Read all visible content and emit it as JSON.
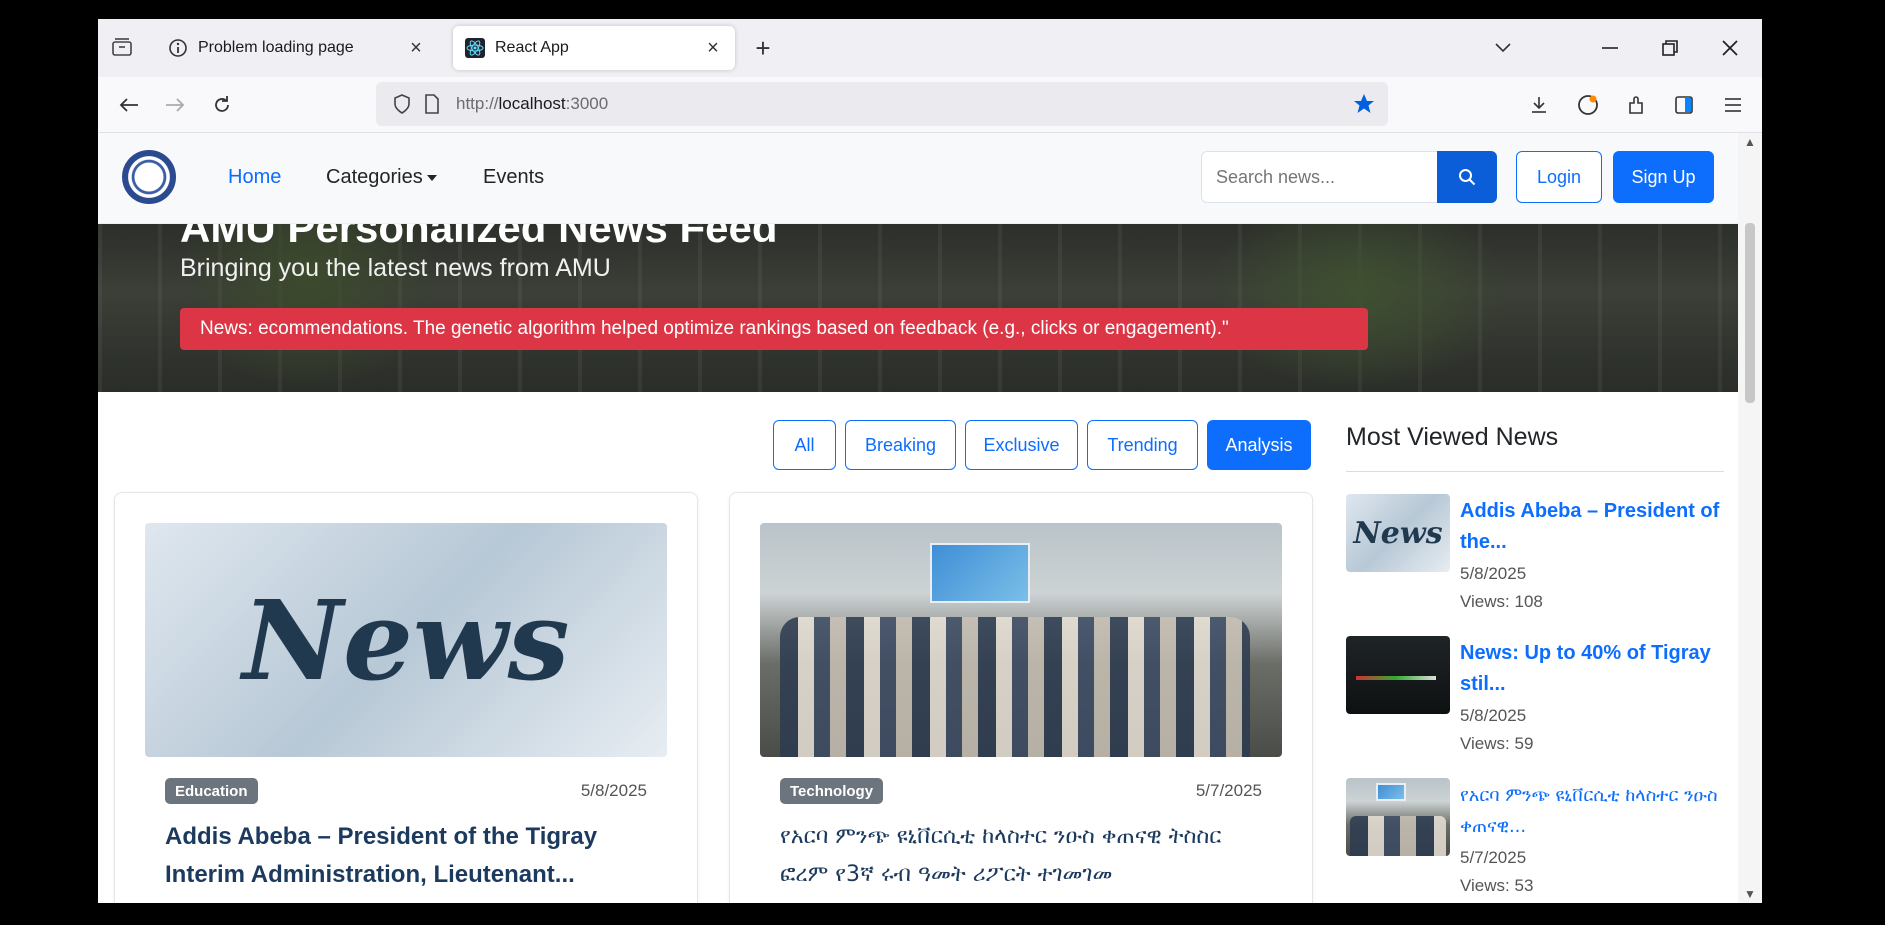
{
  "browser": {
    "tabs": [
      {
        "title": "Problem loading page",
        "icon": "info-icon"
      },
      {
        "title": "React App",
        "icon": "react-icon"
      }
    ],
    "url_prefix": "http://",
    "url_host": "localhost",
    "url_port": ":3000"
  },
  "site": {
    "nav": {
      "home": "Home",
      "categories": "Categories",
      "events": "Events",
      "search_placeholder": "Search news...",
      "login": "Login",
      "signup": "Sign Up"
    },
    "hero": {
      "title_fragment": "AMU Personalized News Feed",
      "subtitle": "Bringing you the latest news from AMU",
      "ticker": "News: ecommendations. The genetic algorithm helped optimize rankings based on feedback (e.g., clicks or engagement).\""
    },
    "filters": [
      "All",
      "Breaking",
      "Exclusive",
      "Trending",
      "Analysis"
    ],
    "active_filter": "Analysis",
    "cards": [
      {
        "category": "Education",
        "date": "5/8/2025",
        "title": "Addis Abeba – President of the Tigray Interim Administration, Lieutenant...",
        "image_text": "News"
      },
      {
        "category": "Technology",
        "date": "5/7/2025",
        "title": "የአርባ ምንጭ ዩኒቨርሲቲ ከላስተር ንዑስ ቀጠናዊ ትስስር ፎረም የ3ኛ ሩብ ዓመት ሪፖርት ተገመገመ"
      }
    ],
    "sidebar": {
      "title": "Most Viewed News",
      "items": [
        {
          "title": "Addis Abeba – President of the...",
          "date": "5/8/2025",
          "views": "Views: 108",
          "thumb_text": "News"
        },
        {
          "title": "News: Up to 40% of Tigray stil...",
          "date": "5/8/2025",
          "views": "Views: 59"
        },
        {
          "title": "የአርባ ምንጭ ዩኒቨርሲቲ ከላስተር ንዑስ ቀጠናዊ...",
          "date": "5/7/2025",
          "views": "Views: 53"
        }
      ]
    }
  }
}
